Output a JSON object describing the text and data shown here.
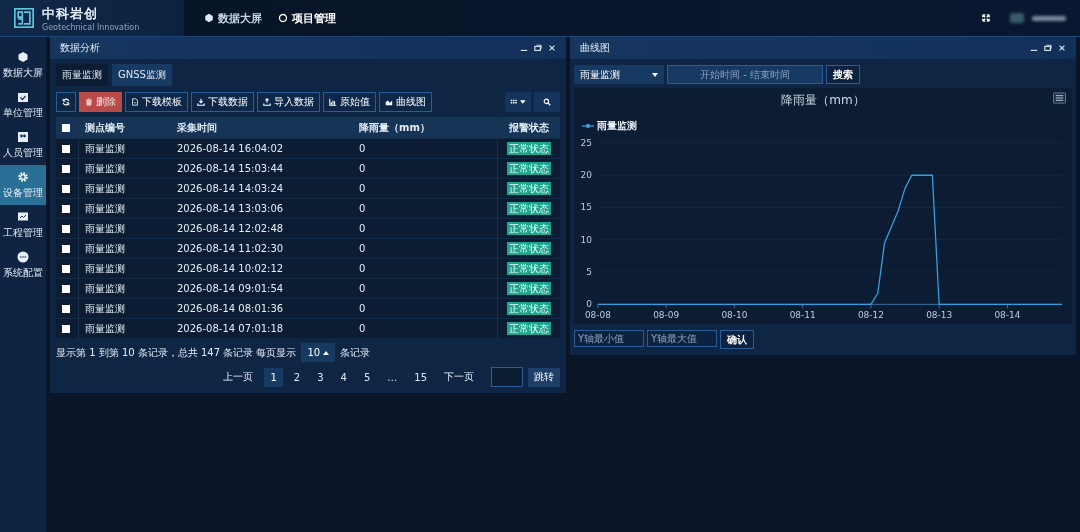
{
  "header": {
    "logo_title": "中科岩创",
    "logo_subtitle": "Geotechnical Innovation",
    "nav": [
      {
        "label": "数据大屏",
        "selected": false
      },
      {
        "label": "项目管理",
        "selected": true
      }
    ]
  },
  "sidebar": {
    "items": [
      {
        "label": "数据大屏",
        "selected": false
      },
      {
        "label": "单位管理",
        "selected": false
      },
      {
        "label": "人员管理",
        "selected": false
      },
      {
        "label": "设备管理",
        "selected": true
      },
      {
        "label": "工程管理",
        "selected": false
      },
      {
        "label": "系统配置",
        "selected": false
      }
    ]
  },
  "left_panel": {
    "title": "数据分析",
    "tabs": [
      {
        "label": "雨量监测",
        "selected": true
      },
      {
        "label": "GNSS监测",
        "selected": false
      }
    ],
    "toolbar": [
      {
        "kind": "refresh"
      },
      {
        "kind": "delete",
        "label": "删除"
      },
      {
        "kind": "file",
        "label": "下载模板"
      },
      {
        "kind": "download",
        "label": "下载数据"
      },
      {
        "kind": "upload",
        "label": "导入数据"
      },
      {
        "kind": "bars",
        "label": "原始值"
      },
      {
        "kind": "area",
        "label": "曲线图"
      }
    ],
    "table": {
      "select_all_checked": false,
      "columns": [
        "测点编号",
        "采集时间",
        "降雨量（mm）",
        "报警状态"
      ],
      "rows": [
        {
          "checked": false,
          "point": "雨量监测",
          "time": "2026-08-14 16:04:02",
          "rain": "0",
          "status": "正常状态"
        },
        {
          "checked": false,
          "point": "雨量监测",
          "time": "2026-08-14 15:03:44",
          "rain": "0",
          "status": "正常状态"
        },
        {
          "checked": false,
          "point": "雨量监测",
          "time": "2026-08-14 14:03:24",
          "rain": "0",
          "status": "正常状态"
        },
        {
          "checked": false,
          "point": "雨量监测",
          "time": "2026-08-14 13:03:06",
          "rain": "0",
          "status": "正常状态"
        },
        {
          "checked": false,
          "point": "雨量监测",
          "time": "2026-08-14 12:02:48",
          "rain": "0",
          "status": "正常状态"
        },
        {
          "checked": false,
          "point": "雨量监测",
          "time": "2026-08-14 11:02:30",
          "rain": "0",
          "status": "正常状态"
        },
        {
          "checked": false,
          "point": "雨量监测",
          "time": "2026-08-14 10:02:12",
          "rain": "0",
          "status": "正常状态"
        },
        {
          "checked": false,
          "point": "雨量监测",
          "time": "2026-08-14 09:01:54",
          "rain": "0",
          "status": "正常状态"
        },
        {
          "checked": false,
          "point": "雨量监测",
          "time": "2026-08-14 08:01:36",
          "rain": "0",
          "status": "正常状态"
        },
        {
          "checked": false,
          "point": "雨量监测",
          "time": "2026-08-14 07:01:18",
          "rain": "0",
          "status": "正常状态"
        }
      ]
    },
    "pagination": {
      "summary": "显示第 1 到第 10 条记录，总共 147 条记录 每页显示",
      "page_size": "10",
      "page_size_suffix": "条记录",
      "prev": "上一页",
      "pages": [
        {
          "label": "1",
          "selected": true
        },
        {
          "label": "2",
          "selected": false
        },
        {
          "label": "3",
          "selected": false
        },
        {
          "label": "4",
          "selected": false
        },
        {
          "label": "5",
          "selected": false
        },
        {
          "label": "…",
          "selected": false
        },
        {
          "label": "15",
          "selected": false
        }
      ],
      "next": "下一页",
      "jump": "跳转"
    }
  },
  "right_panel": {
    "title": "曲线图",
    "select_value": "雨量监测",
    "date_placeholder": "开始时间 - 结束时间",
    "search": "搜索",
    "y_min_placeholder": "Y轴最小值",
    "y_max_placeholder": "Y轴最大值",
    "confirm": "确认",
    "chart_data": {
      "type": "line",
      "title": "降雨量（mm）",
      "categories": [
        "08-08",
        null,
        null,
        null,
        null,
        null,
        null,
        null,
        null,
        null,
        "08-09",
        null,
        null,
        null,
        null,
        null,
        null,
        null,
        null,
        null,
        "08-10",
        null,
        null,
        null,
        null,
        null,
        null,
        null,
        null,
        null,
        "08-11",
        null,
        null,
        null,
        null,
        null,
        null,
        null,
        null,
        null,
        "08-12",
        null,
        null,
        null,
        null,
        null,
        null,
        null,
        null,
        null,
        "08-13",
        null,
        null,
        null,
        null,
        null,
        null,
        null,
        null,
        null,
        "08-14",
        null,
        null,
        null,
        null,
        null,
        null,
        null,
        null
      ],
      "series": [
        {
          "name": "雨量监测",
          "color": "#3a9de0",
          "values": [
            0,
            0,
            0,
            0,
            0,
            0,
            0,
            0,
            0,
            0,
            0,
            0,
            0,
            0,
            0,
            0,
            0,
            0,
            0,
            0,
            0,
            0,
            0,
            0,
            0,
            0,
            0,
            0,
            0,
            0,
            0,
            0,
            0,
            0,
            0,
            0,
            0,
            0,
            0,
            0,
            0,
            1.7,
            9.5,
            12,
            14.5,
            18,
            20,
            20,
            20,
            20,
            0,
            0,
            0,
            0,
            0,
            0,
            0,
            0,
            0,
            0,
            0,
            0,
            0,
            0,
            0,
            0,
            0,
            0,
            0
          ]
        }
      ],
      "ylim": [
        0,
        25
      ],
      "yticks": [
        0,
        5,
        10,
        15,
        20,
        25
      ],
      "grid": true
    }
  }
}
